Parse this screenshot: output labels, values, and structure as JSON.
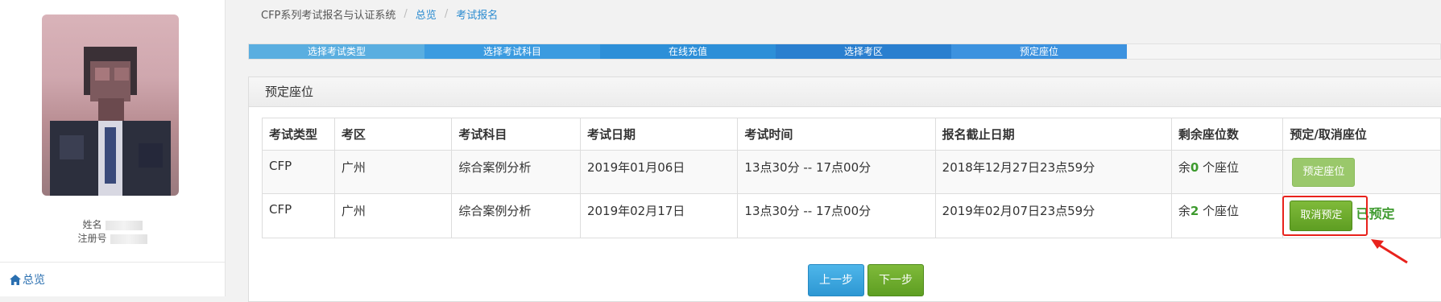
{
  "sidebar": {
    "name_label": "姓名",
    "reg_label": "注册号",
    "nav_overview": "总览"
  },
  "breadcrumb": {
    "system": "CFP系列考试报名与认证系统",
    "overview": "总览",
    "current": "考试报名"
  },
  "steps": [
    {
      "label": "选择考试类型",
      "color": "#5aaee0"
    },
    {
      "label": "选择考试科目",
      "color": "#3b9be0"
    },
    {
      "label": "在线充值",
      "color": "#2d8fd8"
    },
    {
      "label": "选择考区",
      "color": "#2a7fcf"
    },
    {
      "label": "预定座位",
      "color": "#3c92df"
    }
  ],
  "panel": {
    "title": "预定座位"
  },
  "table": {
    "headers": [
      "考试类型",
      "考区",
      "考试科目",
      "考试日期",
      "考试时间",
      "报名截止日期",
      "剩余座位数",
      "预定/取消座位"
    ],
    "rows": [
      {
        "type": "CFP",
        "area": "广州",
        "subject": "综合案例分析",
        "date": "2019年01月06日",
        "time": "13点30分 -- 17点00分",
        "deadline": "2018年12月27日23点59分",
        "seats_prefix": "余",
        "seats": "0",
        "seats_suffix": " 个座位",
        "action": "预定座位",
        "note": ""
      },
      {
        "type": "CFP",
        "area": "广州",
        "subject": "综合案例分析",
        "date": "2019年02月17日",
        "time": "13点30分 -- 17点00分",
        "deadline": "2019年02月07日23点59分",
        "seats_prefix": "余",
        "seats": "2",
        "seats_suffix": " 个座位",
        "action": "取消预定",
        "note": "已预定"
      }
    ]
  },
  "pager": {
    "prev": "上一步",
    "next": "下一步"
  },
  "colors": {
    "accent_blue": "#2a8bd0",
    "green": "#5e9e22",
    "highlight_red": "#e8221c"
  }
}
